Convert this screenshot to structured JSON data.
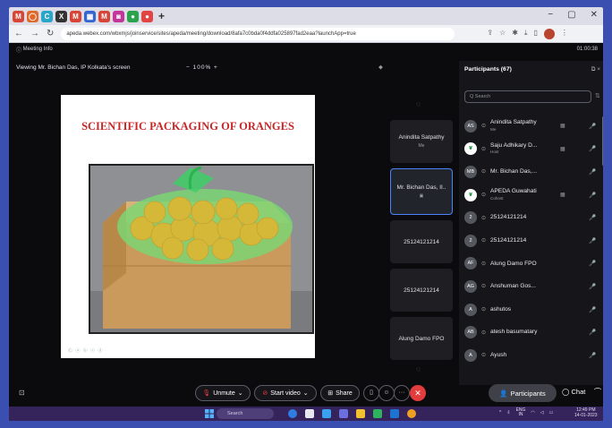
{
  "browser": {
    "tabs": [
      {
        "icon": "gmail-icon",
        "glyph": "M",
        "color": "#d64535"
      },
      {
        "icon": "app-icon",
        "glyph": "◯",
        "color": "#e0692a"
      },
      {
        "icon": "app-icon",
        "glyph": "C",
        "color": "#2aa6c9"
      },
      {
        "icon": "app-icon",
        "glyph": "X",
        "color": "#333333"
      },
      {
        "icon": "gmail-icon",
        "glyph": "M",
        "color": "#d64535"
      },
      {
        "icon": "app-icon",
        "glyph": "▦",
        "color": "#3466d1"
      },
      {
        "icon": "gmail-icon",
        "glyph": "M",
        "color": "#d64535"
      },
      {
        "icon": "app-icon",
        "glyph": "◙",
        "color": "#c4359a"
      },
      {
        "icon": "app-icon",
        "glyph": "●",
        "color": "#2aa34c"
      },
      {
        "icon": "app-icon",
        "glyph": "●",
        "color": "#e24444"
      }
    ],
    "new_tab": "+",
    "url": "apeda.webex.com/wbxmjs/joinservice/sites/apeda/meeting/download/8afa7c0bda0f4ddfa025897fad2eaa?launchApp=true"
  },
  "meeting": {
    "info_label": "Meeting Info",
    "timer": "01:00:38",
    "viewing_label": "Viewing Mr. Bichan Das, IP Kolkata's screen",
    "zoom_minus": "−",
    "zoom_level": "100%",
    "zoom_plus": "+"
  },
  "slide": {
    "title": "SCIENTIFIC PACKAGING OF ORANGES",
    "footer": "Ⓒ ⓐ ⓑ ⓒ ⓓ"
  },
  "tiles": [
    {
      "name": "Anindita Satpathy",
      "sub": "Me"
    },
    {
      "name": "Mr. Bichan Das, II..",
      "sub": "▣"
    },
    {
      "name": "25124121214",
      "sub": ""
    },
    {
      "name": "25124121214",
      "sub": ""
    },
    {
      "name": "Alung Damo FPO",
      "sub": ""
    }
  ],
  "panel": {
    "title": "Participants (67)",
    "search_placeholder": "Q  Search",
    "participants": [
      {
        "initials": "AS",
        "name": "Anindita Satpathy",
        "role": "Me",
        "video": "▦",
        "mic": "🎤",
        "logo": false,
        "mic_on": false
      },
      {
        "initials": "❦",
        "name": "Saju Adhikary D...",
        "role": "Host",
        "video": "▦",
        "mic": "🎤",
        "logo": true,
        "mic_on": false
      },
      {
        "initials": "MB",
        "name": "Mr. Bichan Das,...",
        "role": "",
        "video": "",
        "mic": "🎤",
        "logo": false,
        "mic_on": true
      },
      {
        "initials": "❦",
        "name": "APEDA Guwahati",
        "role": "Cohost",
        "video": "▦",
        "mic": "🎤",
        "logo": true,
        "mic_on": false
      },
      {
        "initials": "2",
        "name": "25124121214",
        "role": "",
        "video": "",
        "mic": "🎤",
        "logo": false,
        "mic_on": false
      },
      {
        "initials": "2",
        "name": "25124121214",
        "role": "",
        "video": "",
        "mic": "🎤",
        "logo": false,
        "mic_on": false
      },
      {
        "initials": "AF",
        "name": "Alung Damo FPO",
        "role": "",
        "video": "",
        "mic": "🎤",
        "logo": false,
        "mic_on": false
      },
      {
        "initials": "AG",
        "name": "Anshuman Gos...",
        "role": "",
        "video": "",
        "mic": "🎤",
        "logo": false,
        "mic_on": false
      },
      {
        "initials": "A",
        "name": "ashutos",
        "role": "",
        "video": "",
        "mic": "🎤",
        "logo": false,
        "mic_on": false
      },
      {
        "initials": "AB",
        "name": "atesh basumatary",
        "role": "",
        "video": "",
        "mic": "🎤",
        "logo": false,
        "mic_on": false
      },
      {
        "initials": "A",
        "name": "Ayush",
        "role": "",
        "video": "",
        "mic": "🎤",
        "logo": false,
        "mic_on": false
      }
    ]
  },
  "controls": {
    "unmute": "Unmute",
    "start_video": "Start video",
    "share": "Share",
    "participants": "Participants",
    "chat": "Chat",
    "more": "···"
  },
  "taskbar": {
    "search_placeholder": "Search",
    "lang": "ENG",
    "lang_sub": "IN",
    "time": "12:49 PM",
    "date": "14-01-2023"
  }
}
